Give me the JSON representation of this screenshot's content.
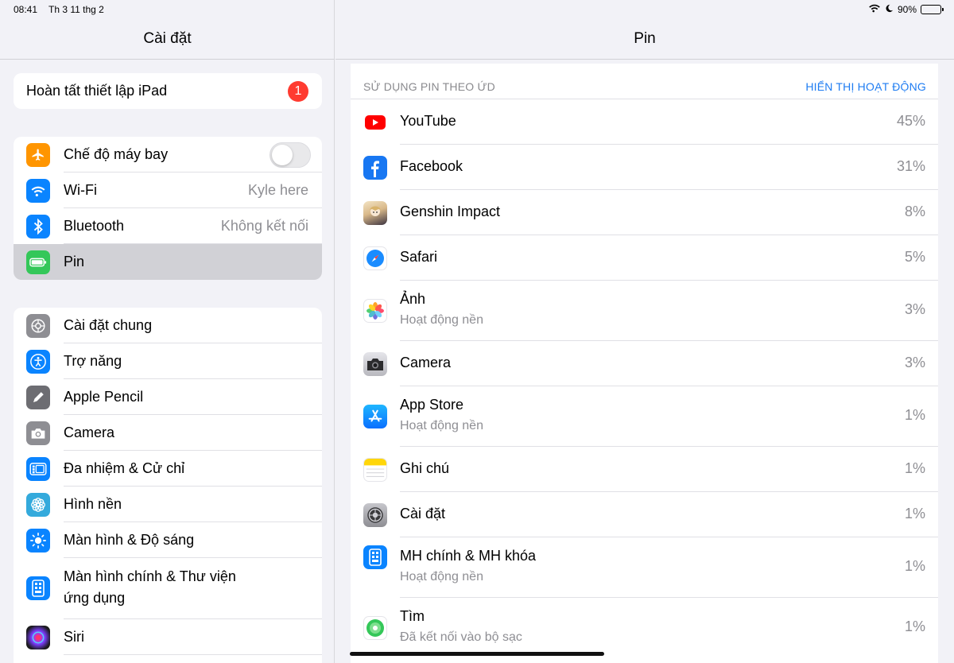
{
  "status": {
    "time": "08:41",
    "date": "Th 3 11 thg 2",
    "battery": "90%",
    "battery_level": 0.9
  },
  "left": {
    "title": "Cài đặt",
    "setup": {
      "label": "Hoàn tất thiết lập iPad",
      "badge": "1"
    },
    "group1": [
      {
        "label": "Chế độ máy bay",
        "icon": "airplane-icon",
        "color": "#ff9500",
        "toggle": false
      },
      {
        "label": "Wi-Fi",
        "icon": "wifi-icon",
        "color": "#0a84ff",
        "value": "Kyle here"
      },
      {
        "label": "Bluetooth",
        "icon": "bluetooth-icon",
        "color": "#0a84ff",
        "value": "Không kết nối"
      },
      {
        "label": "Pin",
        "icon": "battery-icon",
        "color": "#34c759",
        "selected": true
      }
    ],
    "group2": [
      {
        "label": "Cài đặt chung",
        "icon": "gear-icon",
        "color": "#8e8e93"
      },
      {
        "label": "Trợ năng",
        "icon": "accessibility-icon",
        "color": "#0a84ff"
      },
      {
        "label": "Apple Pencil",
        "icon": "pencil-icon",
        "color": "#6d6d72"
      },
      {
        "label": "Camera",
        "icon": "camera-icon",
        "color": "#8e8e93"
      },
      {
        "label": "Đa nhiệm & Cử chỉ",
        "icon": "multitask-icon",
        "color": "#0a84ff"
      },
      {
        "label": "Hình nền",
        "icon": "wallpaper-icon",
        "color": "#34aadc"
      },
      {
        "label": "Màn hình & Độ sáng",
        "icon": "brightness-icon",
        "color": "#0a84ff"
      },
      {
        "label": "Màn hình chính & Thư viện",
        "label2": "ứng dụng",
        "icon": "homescreen-icon",
        "color": "#0a84ff"
      },
      {
        "label": "Siri",
        "icon": "siri-icon",
        "color": "#1c1c1e"
      }
    ]
  },
  "right": {
    "title": "Pin",
    "section_title": "SỬ DỤNG PIN THEO ỨD",
    "section_action": "HIỂN THỊ HOẠT ĐỘNG",
    "apps": [
      {
        "name": "YouTube",
        "pct": "45%",
        "icon": "youtube-icon"
      },
      {
        "name": "Facebook",
        "pct": "31%",
        "icon": "facebook-icon"
      },
      {
        "name": "Genshin Impact",
        "pct": "8%",
        "icon": "genshin-icon"
      },
      {
        "name": "Safari",
        "pct": "5%",
        "icon": "safari-icon"
      },
      {
        "name": "Ảnh",
        "sub": "Hoạt động nền",
        "pct": "3%",
        "icon": "photos-icon"
      },
      {
        "name": "Camera",
        "pct": "3%",
        "icon": "camera-icon"
      },
      {
        "name": "App Store",
        "sub": "Hoạt động nền",
        "pct": "1%",
        "icon": "appstore-icon"
      },
      {
        "name": "Ghi chú",
        "pct": "1%",
        "icon": "notes-icon"
      },
      {
        "name": "Cài đặt",
        "pct": "1%",
        "icon": "settings-icon"
      },
      {
        "name": "MH chính & MH khóa",
        "sub": "Hoạt động nền",
        "pct": "1%",
        "icon": "homescreen-icon"
      },
      {
        "name": "Tìm",
        "sub": "Đã kết nối vào bộ sạc",
        "pct": "1%",
        "icon": "findmy-icon"
      }
    ]
  }
}
